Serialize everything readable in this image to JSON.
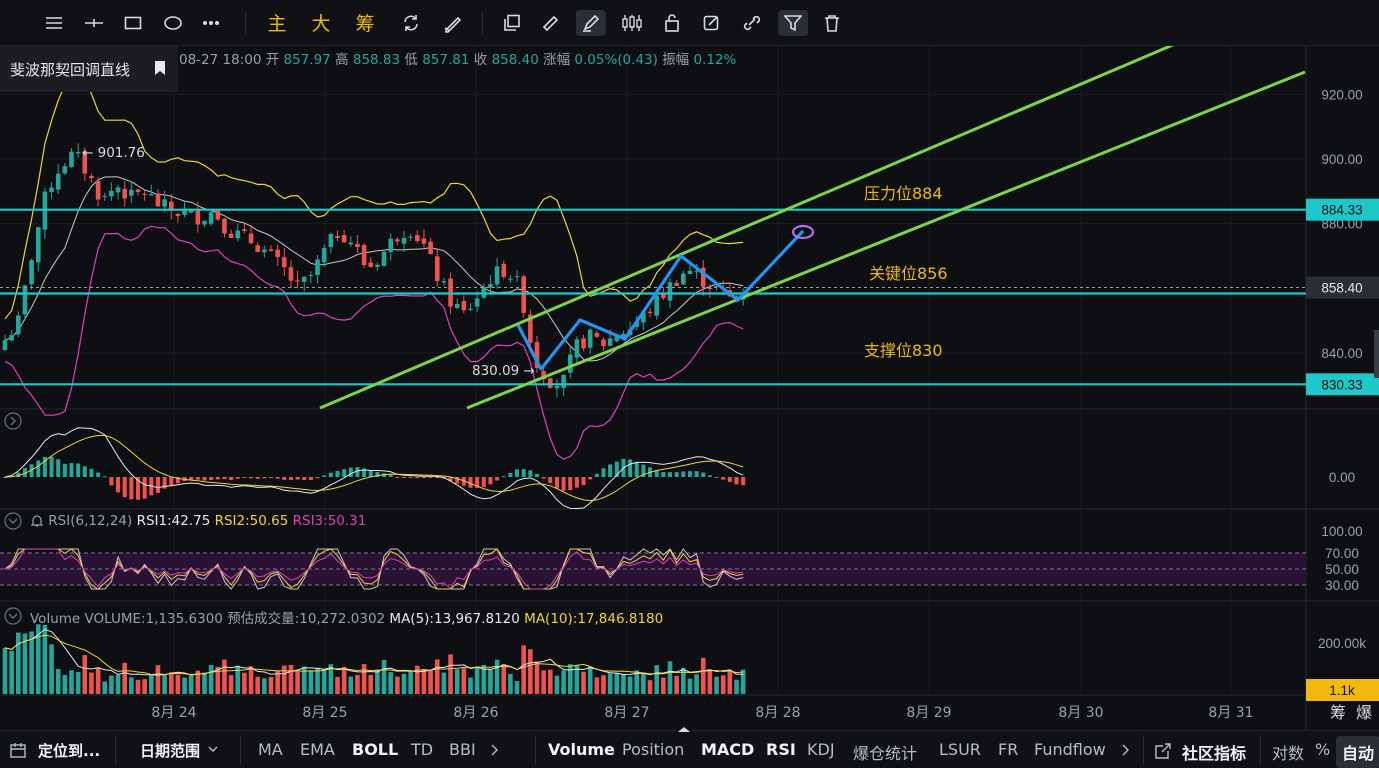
{
  "toolbar": {
    "labels": [
      "主",
      "大",
      "筹"
    ],
    "tools": [
      "horizontal-lines-icon",
      "crosshair-icon",
      "rectangle-icon",
      "ellipse-icon",
      "more-icon",
      "undo-redo-icon",
      "pencil-eraser-icon",
      "copy-icon",
      "ruler-icon",
      "brush-icon",
      "candles-icon",
      "lock-icon",
      "edit-icon",
      "link-icon",
      "filter-icon",
      "trash-icon"
    ]
  },
  "drawing_label": "斐波那契回调直线",
  "ohlc_legend": {
    "date": "08-27 18:00",
    "open_label": "开",
    "open": "857.97",
    "high_label": "高",
    "high": "858.83",
    "low_label": "低",
    "low": "857.81",
    "close_label": "收",
    "close": "858.40",
    "change_label": "涨幅",
    "change": "0.05%(0.43)",
    "amp_label": "振幅",
    "amp": "0.12%"
  },
  "annotations": {
    "resistance": "压力位884",
    "key": "关键位856",
    "support": "支撑位830",
    "high_marker": "← 901.76",
    "low_marker": "830.09 →"
  },
  "price_axis": {
    "ticks": [
      "920.00",
      "900.00",
      "880.00",
      "840.00"
    ],
    "badges": [
      "884.33",
      "858.40",
      "830.33"
    ]
  },
  "macd_axis": {
    "ticks": [
      "0.00"
    ]
  },
  "rsi_legend": {
    "name": "RSI(6,12,24)",
    "rsi1": "RSI1:42.75",
    "rsi2": "RSI2:50.65",
    "rsi3": "RSI3:50.31",
    "ticks": [
      "100.00",
      "70.00",
      "50.00",
      "30.00"
    ]
  },
  "volume_legend": {
    "name": "Volume",
    "volume": "VOLUME:1,135.6300",
    "estimate": "预估成交量:10,272.0302",
    "ma5": "MA(5):13,967.8120",
    "ma10": "MA(10):17,846.8180",
    "ticks": [
      "200.00k"
    ],
    "badge": "1.1k"
  },
  "time_axis": [
    "8月 24",
    "8月 25",
    "8月 26",
    "8月 27",
    "8月 28",
    "8月 29",
    "8月 30",
    "8月 31"
  ],
  "corner_labels": [
    "筹",
    "爆"
  ],
  "bottom_bar": {
    "locate": "定位到...",
    "range": "日期范围",
    "main_indicators": [
      "MA",
      "EMA",
      "BOLL",
      "TD",
      "BBI"
    ],
    "sub_indicators": [
      "Volume",
      "Position",
      "MACD",
      "RSI",
      "KDJ",
      "爆仓统计",
      "LSUR",
      "FR",
      "Fundflow"
    ],
    "community": "社区指标",
    "log": "对数",
    "percent": "%",
    "auto": "自动"
  },
  "colors": {
    "up": "#26a69a",
    "down": "#ef5350",
    "level": "#1ec8c8",
    "channel": "#7ed348",
    "pattern": "#2196f3",
    "annotation": "#f0b90b",
    "boll_upper": "#f0d43a",
    "boll_mid": "#c9c9c9",
    "boll_lower": "#e040c0"
  },
  "chart_data": {
    "type": "candlestick",
    "title": "",
    "xlabel": "",
    "ylabel": "",
    "x_ticks": [
      "8月 24",
      "8月 25",
      "8月 26",
      "8月 27",
      "8月 28",
      "8月 29",
      "8月 30",
      "8月 31"
    ],
    "ylim": [
      823,
      930
    ],
    "y_ticks": [
      840,
      880,
      900,
      920
    ],
    "price_path": [
      844,
      850,
      872,
      890,
      898,
      901.76,
      895,
      887,
      892,
      888,
      890,
      886,
      884,
      883,
      882,
      884,
      878,
      876,
      874,
      870,
      866,
      860,
      864,
      872,
      878,
      874,
      866,
      870,
      876,
      879,
      874,
      864,
      856,
      852,
      858,
      864,
      866,
      860,
      838,
      832,
      830.09,
      842,
      845,
      843,
      846,
      848,
      852,
      857,
      862,
      866,
      863,
      860,
      857,
      858.4
    ],
    "levels": [
      {
        "label": "压力位884",
        "price": 884.33
      },
      {
        "label": "关键位856",
        "price": 858.4
      },
      {
        "label": "支撑位830",
        "price": 830.33
      }
    ],
    "channel": {
      "upper": [
        [
          838,
          820
        ],
        [
          940,
          977
        ]
      ],
      "lower": [
        [
          805,
          806
        ],
        [
          940,
          951
        ]
      ]
    },
    "projection": [
      830.09,
      846,
      841,
      868,
      855,
      876
    ],
    "grid": true
  }
}
